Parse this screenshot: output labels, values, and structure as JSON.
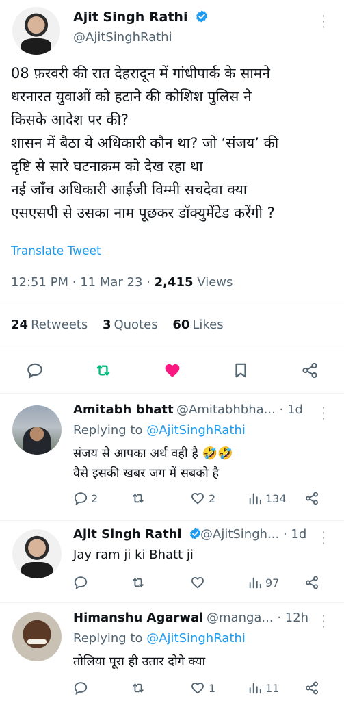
{
  "main_tweet": {
    "author_name": "Ajit Singh Rathi",
    "author_handle": "@AjitSinghRathi",
    "text_lines": [
      "08 फ़रवरी की रात देहरादून में गांधीपार्क के सामने",
      "धरनारत युवाओं को हटाने की कोशिश पुलिस ने",
      "किसके आदेश पर की?",
      "शासन में बैठा ये अधिकारी कौन था? जो ‘संजय’ की",
      "दृष्टि से सारे घटनाक्रम को देख रहा था",
      "नई जाँच अधिकारी आईजी विम्मी सचदेवा क्या",
      "एसएसपी से उसका नाम पूछकर डॉक्युमेंटेड करेंगी ?"
    ],
    "translate_label": "Translate Tweet",
    "time": "12:51 PM",
    "date": "11 Mar 23",
    "views_count": "2,415",
    "views_label": "Views",
    "retweets_count": "24",
    "retweets_label": "Retweets",
    "quotes_count": "3",
    "quotes_label": "Quotes",
    "likes_count": "60",
    "likes_label": "Likes",
    "accent": "#1d9bf0",
    "like_color": "#f91880",
    "retweet_color": "#00ba7c"
  },
  "replies": [
    {
      "name": "Amitabh bhatt",
      "handle": "@Amitabhbha...",
      "age": "· 1d",
      "replying_prefix": "Replying to ",
      "replying_to": "@AjitSinghRathi",
      "lines": [
        "संजय से आपका अर्थ वही है 🤣🤣",
        "वैसे इसकी खबर जग में सबको है"
      ],
      "replies": "2",
      "retweets": "",
      "likes": "2",
      "views": "134"
    },
    {
      "name": "Ajit Singh Rathi",
      "handle": "@AjitSingh...",
      "age": "· 1d",
      "lines": [
        "Jay ram ji ki Bhatt ji"
      ],
      "replies": "",
      "retweets": "",
      "likes": "",
      "views": "97"
    },
    {
      "name": "Himanshu Agarwal",
      "handle": "@manga...",
      "age": "· 12h",
      "replying_prefix": "Replying to ",
      "replying_to": "@AjitSinghRathi",
      "lines": [
        "तोलिया पूरा ही उतार दोगे क्या"
      ],
      "replies": "",
      "retweets": "",
      "likes": "1",
      "views": "11"
    }
  ]
}
